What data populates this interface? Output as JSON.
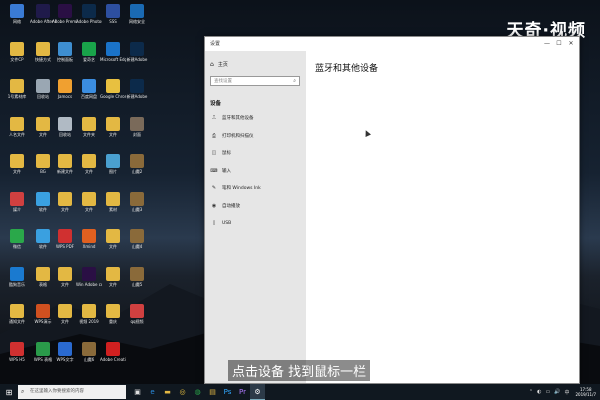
{
  "watermark": "天奇·视频",
  "subtitle": "点击设备 找到鼠标一栏",
  "desktop_icons": [
    {
      "label": "网络",
      "color": "#3a7bd5"
    },
    {
      "label": "Adobe After Effects CC",
      "color": "#1f1a4a"
    },
    {
      "label": "Adobe Premiere P...",
      "color": "#2a0f44"
    },
    {
      "label": "Adobe Photosh...",
      "color": "#0c2a4a"
    },
    {
      "label": "SSS",
      "color": "#2d4fa0"
    },
    {
      "label": "网络安全",
      "color": "#1a6ab3"
    },
    {
      "label": "文件CP",
      "color": "#e3b843"
    },
    {
      "label": "快捷方式",
      "color": "#e3b843"
    },
    {
      "label": "控制面板",
      "color": "#3e8ed0"
    },
    {
      "label": "爱奇艺",
      "color": "#19a34a"
    },
    {
      "label": "Microsoft Edge",
      "color": "#1a73c9"
    },
    {
      "label": "新建Adobe",
      "color": "#0c2a4a"
    },
    {
      "label": "1号素材库",
      "color": "#e3b843"
    },
    {
      "label": "回收站",
      "color": "#9aa7b3"
    },
    {
      "label": "Jamocs",
      "color": "#f0a030"
    },
    {
      "label": "百度网盘",
      "color": "#3b8de0"
    },
    {
      "label": "Google Chrome",
      "color": "#e8c040"
    },
    {
      "label": "新建Adobe",
      "color": "#0c2a4a"
    },
    {
      "label": "人名文件",
      "color": "#e3b843"
    },
    {
      "label": "文件",
      "color": "#e3b843"
    },
    {
      "label": "回收站",
      "color": "#b0bac4"
    },
    {
      "label": "文件夹",
      "color": "#e3b843"
    },
    {
      "label": "文件",
      "color": "#e3b843"
    },
    {
      "label": "封面",
      "color": "#7a6a5a"
    },
    {
      "label": "文件",
      "color": "#e3b843"
    },
    {
      "label": "BG",
      "color": "#e3b843"
    },
    {
      "label": "新建文件",
      "color": "#e3b843"
    },
    {
      "label": "文件",
      "color": "#e3b843"
    },
    {
      "label": "图片",
      "color": "#4aa0d0"
    },
    {
      "label": "山魔2",
      "color": "#8a6a3a"
    },
    {
      "label": "媒介",
      "color": "#d04040"
    },
    {
      "label": "软件",
      "color": "#3aa0e0"
    },
    {
      "label": "文件",
      "color": "#e3b843"
    },
    {
      "label": "文件",
      "color": "#e3b843"
    },
    {
      "label": "素材",
      "color": "#e3b843"
    },
    {
      "label": "山魔3",
      "color": "#8a6a3a"
    },
    {
      "label": "微信",
      "color": "#2aa84a"
    },
    {
      "label": "软件",
      "color": "#3aa0e0"
    },
    {
      "label": "WPS PDF",
      "color": "#d03030"
    },
    {
      "label": "Xmind",
      "color": "#e06020"
    },
    {
      "label": "文件",
      "color": "#e3b843"
    },
    {
      "label": "山魔4",
      "color": "#8a6a3a"
    },
    {
      "label": "酷狗音乐",
      "color": "#1a7ad0"
    },
    {
      "label": "表格",
      "color": "#e3b843"
    },
    {
      "label": "文件",
      "color": "#e3b843"
    },
    {
      "label": "Win Adobe cc 2018",
      "color": "#2a0f44"
    },
    {
      "label": "文件",
      "color": "#e3b843"
    },
    {
      "label": "山魔5",
      "color": "#8a6a3a"
    },
    {
      "label": "通知文件",
      "color": "#e3b843"
    },
    {
      "label": "WPS演示",
      "color": "#d05020"
    },
    {
      "label": "文件",
      "color": "#e3b843"
    },
    {
      "label": "视频 2019",
      "color": "#e3b843"
    },
    {
      "label": "重庆",
      "color": "#e3b843"
    },
    {
      "label": "qq视频",
      "color": "#d04040"
    },
    {
      "label": "WPS H5",
      "color": "#d03030"
    },
    {
      "label": "WPS 表格",
      "color": "#2a9a4a"
    },
    {
      "label": "WPS文字",
      "color": "#2a6ad0"
    },
    {
      "label": "山魔6",
      "color": "#8a6a3a"
    },
    {
      "label": "Adobe Creati...",
      "color": "#d02020"
    }
  ],
  "settings": {
    "window_title": "设置",
    "win_min": "—",
    "win_max": "☐",
    "win_close": "✕",
    "home_label": "主页",
    "search_placeholder": "查找设置",
    "section_label": "设备",
    "nav_items": [
      {
        "icon": "bluetooth-icon",
        "glyph": "⎍",
        "label": "蓝牙和其他设备"
      },
      {
        "icon": "printer-icon",
        "glyph": "⎙",
        "label": "打印机和扫描仪"
      },
      {
        "icon": "mouse-icon",
        "glyph": "◫",
        "label": "鼠标"
      },
      {
        "icon": "keyboard-icon",
        "glyph": "⌨",
        "label": "输入"
      },
      {
        "icon": "pen-icon",
        "glyph": "✎",
        "label": "笔和 Windows Ink"
      },
      {
        "icon": "autoplay-icon",
        "glyph": "◉",
        "label": "自动播放"
      },
      {
        "icon": "usb-icon",
        "glyph": "▯",
        "label": "USB"
      }
    ],
    "content_title": "蓝牙和其他设备"
  },
  "taskbar": {
    "start_glyph": "⊞",
    "search_placeholder": "在这里输入你要搜索的内容",
    "apps": [
      {
        "icon": "task-view-icon",
        "glyph": "▣",
        "color": "#ddd"
      },
      {
        "icon": "edge-icon",
        "glyph": "e",
        "color": "#2a8de0"
      },
      {
        "icon": "folder-icon",
        "glyph": "▬",
        "color": "#e3b843"
      },
      {
        "icon": "chrome-icon",
        "glyph": "◎",
        "color": "#e8c040"
      },
      {
        "icon": "wechat-icon",
        "glyph": "◍",
        "color": "#2aa84a"
      },
      {
        "icon": "file-explorer-icon",
        "glyph": "▤",
        "color": "#e3b843"
      },
      {
        "icon": "photoshop-icon",
        "glyph": "Ps",
        "color": "#31a8ff"
      },
      {
        "icon": "premiere-icon",
        "glyph": "Pr",
        "color": "#b07aff"
      },
      {
        "icon": "settings-icon",
        "glyph": "⚙",
        "color": "#ffffff"
      }
    ],
    "tray": [
      "⌃",
      "◐",
      "▭",
      "🔊",
      "中"
    ],
    "time": "17:58",
    "date": "2019/11/7"
  },
  "colors": {
    "nav_bg": "#e6e6e6",
    "window_bg": "#ffffff",
    "taskbar_bg": "#101820"
  }
}
